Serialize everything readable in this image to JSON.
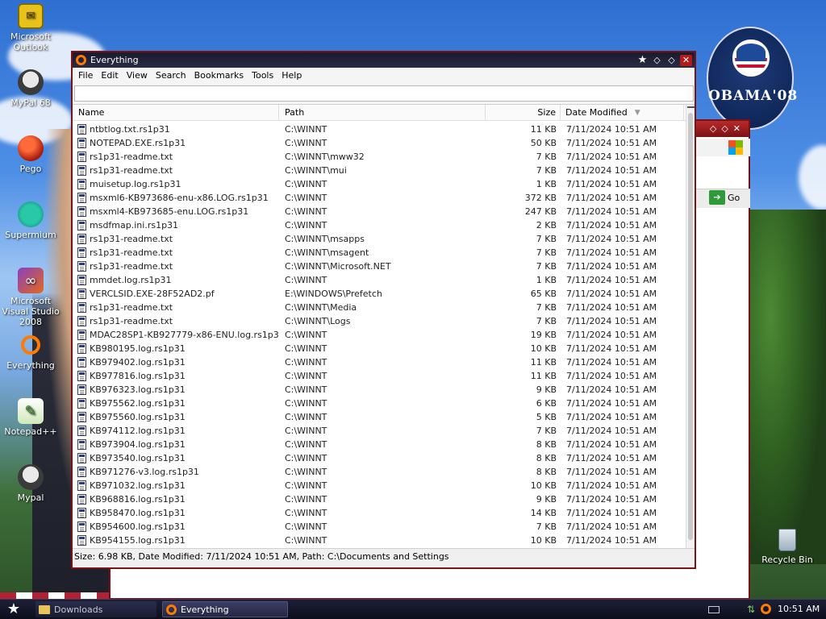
{
  "desktop": {
    "icons": [
      {
        "label": "Microsoft Outlook",
        "icon": "outlook-icon"
      },
      {
        "label": "MyPal 68",
        "icon": "raccoon-icon"
      },
      {
        "label": "Pego",
        "icon": "pego-icon"
      },
      {
        "label": "Supermium",
        "icon": "supermium-icon"
      },
      {
        "label": "Microsoft Visual Studio 2008",
        "icon": "visual-studio-icon"
      },
      {
        "label": "Everything",
        "icon": "everything-icon"
      },
      {
        "label": "Notepad++",
        "icon": "notepadpp-icon"
      },
      {
        "label": "Mypal",
        "icon": "raccoon-icon"
      }
    ],
    "recycle_bin": "Recycle Bin",
    "badge_text": "OBAMA'08"
  },
  "background_window": {
    "go_label": "Go"
  },
  "window": {
    "title": "Everything",
    "menu": [
      "File",
      "Edit",
      "View",
      "Search",
      "Bookmarks",
      "Tools",
      "Help"
    ],
    "search": {
      "value": ""
    },
    "columns": {
      "name": "Name",
      "path": "Path",
      "size": "Size",
      "date": "Date Modified"
    },
    "rows": [
      {
        "name": "ntbtlog.txt.rs1p31",
        "path": "C:\\WINNT",
        "size": "11 KB",
        "date": "7/11/2024 10:51 AM"
      },
      {
        "name": "NOTEPAD.EXE.rs1p31",
        "path": "C:\\WINNT",
        "size": "50 KB",
        "date": "7/11/2024 10:51 AM"
      },
      {
        "name": "rs1p31-readme.txt",
        "path": "C:\\WINNT\\mww32",
        "size": "7 KB",
        "date": "7/11/2024 10:51 AM"
      },
      {
        "name": "rs1p31-readme.txt",
        "path": "C:\\WINNT\\mui",
        "size": "7 KB",
        "date": "7/11/2024 10:51 AM"
      },
      {
        "name": "muisetup.log.rs1p31",
        "path": "C:\\WINNT",
        "size": "1 KB",
        "date": "7/11/2024 10:51 AM"
      },
      {
        "name": "msxml6-KB973686-enu-x86.LOG.rs1p31",
        "path": "C:\\WINNT",
        "size": "372 KB",
        "date": "7/11/2024 10:51 AM"
      },
      {
        "name": "msxml4-KB973685-enu.LOG.rs1p31",
        "path": "C:\\WINNT",
        "size": "247 KB",
        "date": "7/11/2024 10:51 AM"
      },
      {
        "name": "msdfmap.ini.rs1p31",
        "path": "C:\\WINNT",
        "size": "2 KB",
        "date": "7/11/2024 10:51 AM"
      },
      {
        "name": "rs1p31-readme.txt",
        "path": "C:\\WINNT\\msapps",
        "size": "7 KB",
        "date": "7/11/2024 10:51 AM"
      },
      {
        "name": "rs1p31-readme.txt",
        "path": "C:\\WINNT\\msagent",
        "size": "7 KB",
        "date": "7/11/2024 10:51 AM"
      },
      {
        "name": "rs1p31-readme.txt",
        "path": "C:\\WINNT\\Microsoft.NET",
        "size": "7 KB",
        "date": "7/11/2024 10:51 AM"
      },
      {
        "name": "mmdet.log.rs1p31",
        "path": "C:\\WINNT",
        "size": "1 KB",
        "date": "7/11/2024 10:51 AM"
      },
      {
        "name": "VERCLSID.EXE-28F52AD2.pf",
        "path": "E:\\WINDOWS\\Prefetch",
        "size": "65 KB",
        "date": "7/11/2024 10:51 AM"
      },
      {
        "name": "rs1p31-readme.txt",
        "path": "C:\\WINNT\\Media",
        "size": "7 KB",
        "date": "7/11/2024 10:51 AM"
      },
      {
        "name": "rs1p31-readme.txt",
        "path": "C:\\WINNT\\Logs",
        "size": "7 KB",
        "date": "7/11/2024 10:51 AM"
      },
      {
        "name": "MDAC28SP1-KB927779-x86-ENU.log.rs1p31",
        "path": "C:\\WINNT",
        "size": "19 KB",
        "date": "7/11/2024 10:51 AM"
      },
      {
        "name": "KB980195.log.rs1p31",
        "path": "C:\\WINNT",
        "size": "10 KB",
        "date": "7/11/2024 10:51 AM"
      },
      {
        "name": "KB979402.log.rs1p31",
        "path": "C:\\WINNT",
        "size": "11 KB",
        "date": "7/11/2024 10:51 AM"
      },
      {
        "name": "KB977816.log.rs1p31",
        "path": "C:\\WINNT",
        "size": "11 KB",
        "date": "7/11/2024 10:51 AM"
      },
      {
        "name": "KB976323.log.rs1p31",
        "path": "C:\\WINNT",
        "size": "9 KB",
        "date": "7/11/2024 10:51 AM"
      },
      {
        "name": "KB975562.log.rs1p31",
        "path": "C:\\WINNT",
        "size": "6 KB",
        "date": "7/11/2024 10:51 AM"
      },
      {
        "name": "KB975560.log.rs1p31",
        "path": "C:\\WINNT",
        "size": "5 KB",
        "date": "7/11/2024 10:51 AM"
      },
      {
        "name": "KB974112.log.rs1p31",
        "path": "C:\\WINNT",
        "size": "7 KB",
        "date": "7/11/2024 10:51 AM"
      },
      {
        "name": "KB973904.log.rs1p31",
        "path": "C:\\WINNT",
        "size": "8 KB",
        "date": "7/11/2024 10:51 AM"
      },
      {
        "name": "KB973540.log.rs1p31",
        "path": "C:\\WINNT",
        "size": "8 KB",
        "date": "7/11/2024 10:51 AM"
      },
      {
        "name": "KB971276-v3.log.rs1p31",
        "path": "C:\\WINNT",
        "size": "8 KB",
        "date": "7/11/2024 10:51 AM"
      },
      {
        "name": "KB971032.log.rs1p31",
        "path": "C:\\WINNT",
        "size": "10 KB",
        "date": "7/11/2024 10:51 AM"
      },
      {
        "name": "KB968816.log.rs1p31",
        "path": "C:\\WINNT",
        "size": "9 KB",
        "date": "7/11/2024 10:51 AM"
      },
      {
        "name": "KB958470.log.rs1p31",
        "path": "C:\\WINNT",
        "size": "14 KB",
        "date": "7/11/2024 10:51 AM"
      },
      {
        "name": "KB954600.log.rs1p31",
        "path": "C:\\WINNT",
        "size": "7 KB",
        "date": "7/11/2024 10:51 AM"
      },
      {
        "name": "KB954155.log.rs1p31",
        "path": "C:\\WINNT",
        "size": "10 KB",
        "date": "7/11/2024 10:51 AM"
      }
    ],
    "status": "Size: 6.98 KB, Date Modified: 7/11/2024 10:51 AM, Path: C:\\Documents and Settings"
  },
  "taskbar": {
    "items": [
      {
        "label": "Downloads",
        "icon": "folder-icon"
      },
      {
        "label": "Everything",
        "icon": "everything-icon"
      }
    ],
    "clock": "10:51 AM"
  }
}
